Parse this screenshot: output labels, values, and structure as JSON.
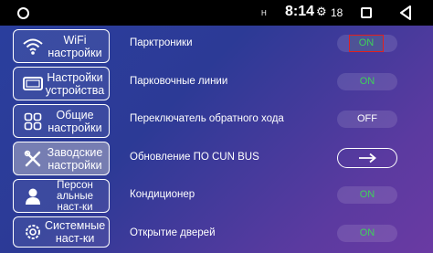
{
  "status": {
    "signal": "H",
    "time": "8:14",
    "num": "18"
  },
  "sidebar": {
    "items": [
      {
        "label": "WiFi\nнастройки",
        "icon": "wifi-icon"
      },
      {
        "label": "Настройки\nустройства",
        "icon": "device-icon"
      },
      {
        "label": "Общие\nнастройки",
        "icon": "grid-icon"
      },
      {
        "label": "Заводские\nнастройки",
        "icon": "tools-icon",
        "active": true
      },
      {
        "label": "Персон\nальные\nнаст-ки",
        "icon": "person-icon"
      },
      {
        "label": "Системные\nнаст-ки",
        "icon": "gear-icon"
      }
    ]
  },
  "settings": {
    "rows": [
      {
        "label": "Парктроники",
        "value": "ON"
      },
      {
        "label": "Парковочные линии",
        "value": "ON"
      },
      {
        "label": "Переключатель обратного хода",
        "value": "OFF"
      },
      {
        "label": "Обновление ПО CUN BUS",
        "value": "→"
      },
      {
        "label": "Кондиционер",
        "value": "ON"
      },
      {
        "label": "Открытие дверей",
        "value": "ON"
      }
    ]
  },
  "colors": {
    "on": "#3fd05a",
    "highlight": "#e02020"
  }
}
